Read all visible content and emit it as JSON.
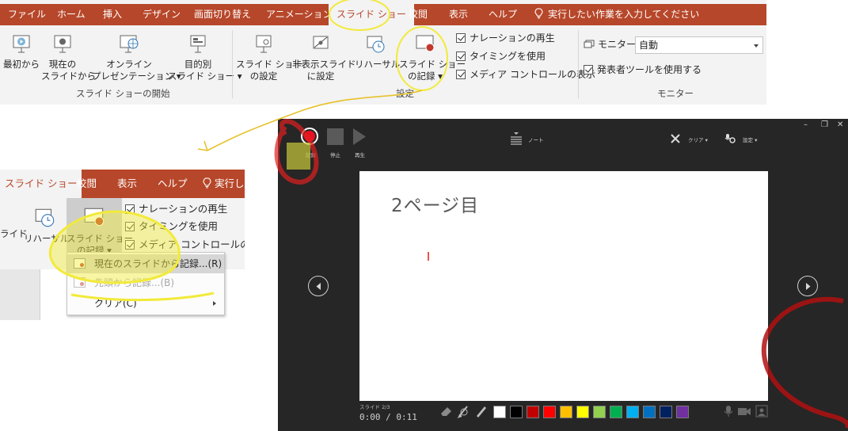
{
  "ribbon": {
    "tabs": [
      "ファイル",
      "ホーム",
      "挿入",
      "デザイン",
      "画面切り替え",
      "アニメーション",
      "スライド ショー",
      "校閲",
      "表示",
      "ヘルプ"
    ],
    "active_tab": "スライド ショー",
    "tell_me": "実行したい作業を入力してください",
    "buttons": {
      "from_start": "最初から",
      "from_current_1": "現在の",
      "from_current_2": "スライドから",
      "online_1": "オンライン",
      "online_2": "プレゼンテーション ▾",
      "custom_1": "目的別",
      "custom_2": "スライド ショー ▾",
      "setup_1": "スライド ショー",
      "setup_2": "の設定",
      "hide_1": "非表示スライド",
      "hide_2": "に設定",
      "rehearse": "リハーサル",
      "record_1": "スライド ショー",
      "record_2": "の記録 ▾"
    },
    "checkboxes": [
      "ナレーションの再生",
      "タイミングを使用",
      "メディア コントロールの表示"
    ],
    "monitor_label": "モニター:",
    "monitor_value": "自動",
    "presenter_view": "発表者ツールを使用する",
    "groups": {
      "start": "スライド ショーの開始",
      "setup": "設定",
      "monitor": "モニター"
    }
  },
  "ribbon_crop": {
    "tabs": [
      "スライド ショー",
      "校閲",
      "表示",
      "ヘルプ"
    ],
    "tell_me": "実行しん",
    "hide_fragment": "ライド",
    "rehearse": "リハーサル",
    "record_1": "スライド ショー",
    "record_2": "の記録 ▾",
    "checkboxes": [
      "ナレーションの再生",
      "タイミングを使用",
      "メディア コントロールの表示"
    ]
  },
  "record_menu": {
    "items": [
      {
        "label": "現在のスライドから記録...(R)"
      },
      {
        "label": "先頭から記録...(B)"
      },
      {
        "label": "クリア(C)"
      }
    ]
  },
  "recorder": {
    "toolbar": {
      "record": "記録",
      "stop": "停止",
      "play": "再生",
      "notes": "ノート",
      "clear": "クリア ▾",
      "settings": "設定 ▾"
    },
    "slide_title": "2ページ目",
    "slide_counter": "スライド 2/3",
    "timer": "0:00 / 0:11",
    "swatches": [
      "#ffffff",
      "#000000",
      "#c00000",
      "#ff0000",
      "#ffc000",
      "#ffff00",
      "#92d050",
      "#00b050",
      "#00b0f0",
      "#0070c0",
      "#002060",
      "#7030a0"
    ]
  },
  "colors": {
    "accent": "#b7472a",
    "annotation_yellow": "#f2ea3a",
    "annotation_red": "#e02020"
  }
}
